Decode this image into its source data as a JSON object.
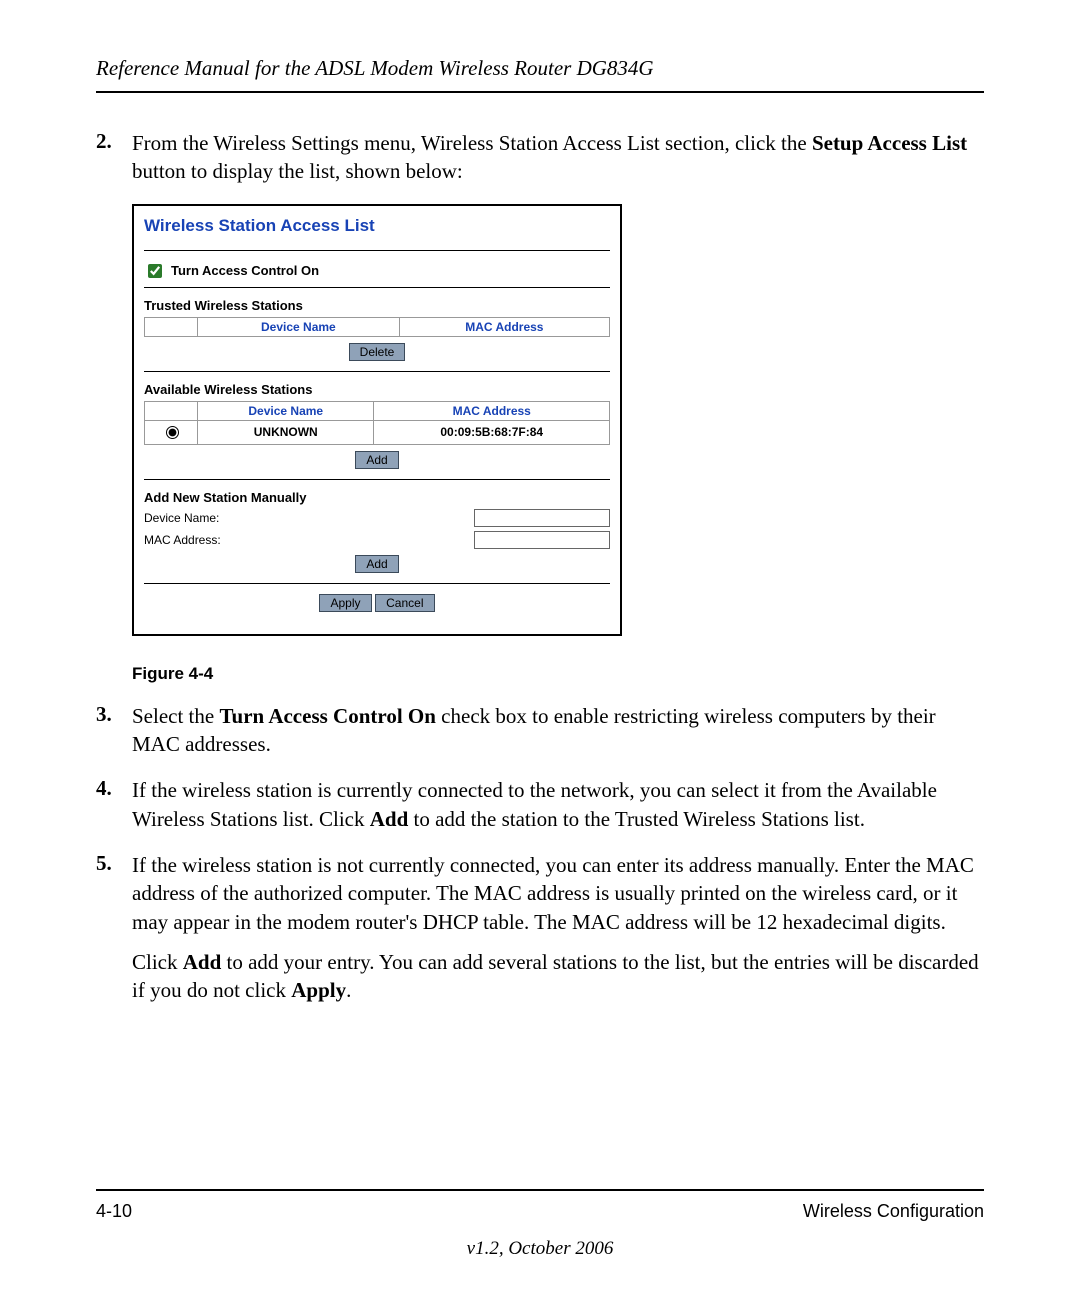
{
  "header": {
    "title": "Reference Manual for the ADSL Modem Wireless Router DG834G"
  },
  "steps": {
    "s2": {
      "num": "2.",
      "text_before_bold": "From the Wireless Settings menu, Wireless Station Access List section, click the ",
      "bold1": "Setup Access List",
      "text_after_bold": " button to display the list, shown below:"
    },
    "figure_caption": "Figure 4-4",
    "s3": {
      "num": "3.",
      "text_before": "Select the ",
      "bold": "Turn Access Control On",
      "text_after": " check box to enable restricting wireless computers by their MAC addresses."
    },
    "s4": {
      "num": "4.",
      "text_before": "If the wireless station is currently connected to the network, you can select it from the Available Wireless Stations list. Click ",
      "bold": "Add",
      "text_after": " to add the station to the Trusted Wireless Stations list."
    },
    "s5": {
      "num": "5.",
      "p1": "If the wireless station is not currently connected, you can enter its address manually. Enter the MAC address of the authorized computer. The MAC address is usually printed on the wireless card, or it may appear in the modem router's DHCP table. The MAC address will be 12 hexadecimal digits.",
      "p2_before": "Click ",
      "p2_bold1": "Add",
      "p2_mid": " to add your entry. You can add several stations to the list, but the entries will be discarded if you do not click ",
      "p2_bold2": "Apply",
      "p2_after": "."
    }
  },
  "router": {
    "title": "Wireless Station Access List",
    "access_control_label": "Turn Access Control On",
    "trusted": {
      "heading": "Trusted Wireless Stations",
      "cols": {
        "device": "Device Name",
        "mac": "MAC Address"
      },
      "delete_btn": "Delete"
    },
    "available": {
      "heading": "Available Wireless Stations",
      "cols": {
        "device": "Device Name",
        "mac": "MAC Address"
      },
      "rows": [
        {
          "device": "UNKNOWN",
          "mac": "00:09:5B:68:7F:84"
        }
      ],
      "add_btn": "Add"
    },
    "manual": {
      "heading": "Add New Station Manually",
      "device_label": "Device Name:",
      "mac_label": "MAC Address:",
      "add_btn": "Add"
    },
    "footer_buttons": {
      "apply": "Apply",
      "cancel": "Cancel"
    }
  },
  "footer": {
    "page_num": "4-10",
    "section": "Wireless Configuration",
    "version": "v1.2, October 2006"
  }
}
